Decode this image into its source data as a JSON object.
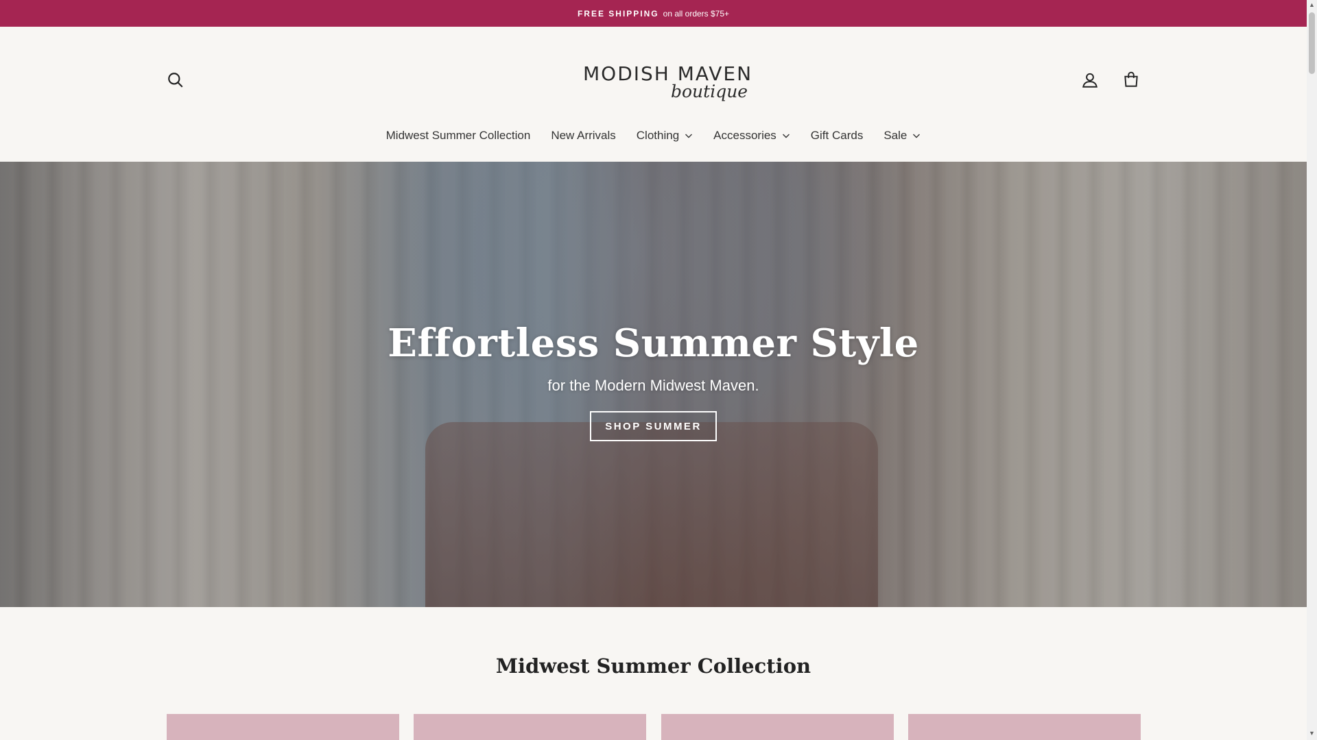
{
  "announcement": {
    "strong": "FREE SHIPPING",
    "rest": "on all orders $75+"
  },
  "header": {
    "logo_brand": "MODISH MAVEN",
    "logo_sub": "boutique",
    "icons": {
      "search": "search-icon",
      "account": "account-icon",
      "cart": "cart-icon"
    }
  },
  "nav": {
    "items": [
      {
        "label": "Midwest Summer Collection",
        "has_dropdown": false
      },
      {
        "label": "New Arrivals",
        "has_dropdown": false
      },
      {
        "label": "Clothing",
        "has_dropdown": true
      },
      {
        "label": "Accessories",
        "has_dropdown": true
      },
      {
        "label": "Gift Cards",
        "has_dropdown": false
      },
      {
        "label": "Sale",
        "has_dropdown": true
      }
    ]
  },
  "hero": {
    "title": "Effortless Summer Style",
    "subtitle": "for the Modern Midwest Maven.",
    "button_label": "SHOP SUMMER"
  },
  "collection": {
    "title": "Midwest Summer Collection"
  },
  "colors": {
    "announcement_bg": "#a52552",
    "page_bg": "#f8f6f3",
    "product_placeholder": "#d7b3bc"
  }
}
